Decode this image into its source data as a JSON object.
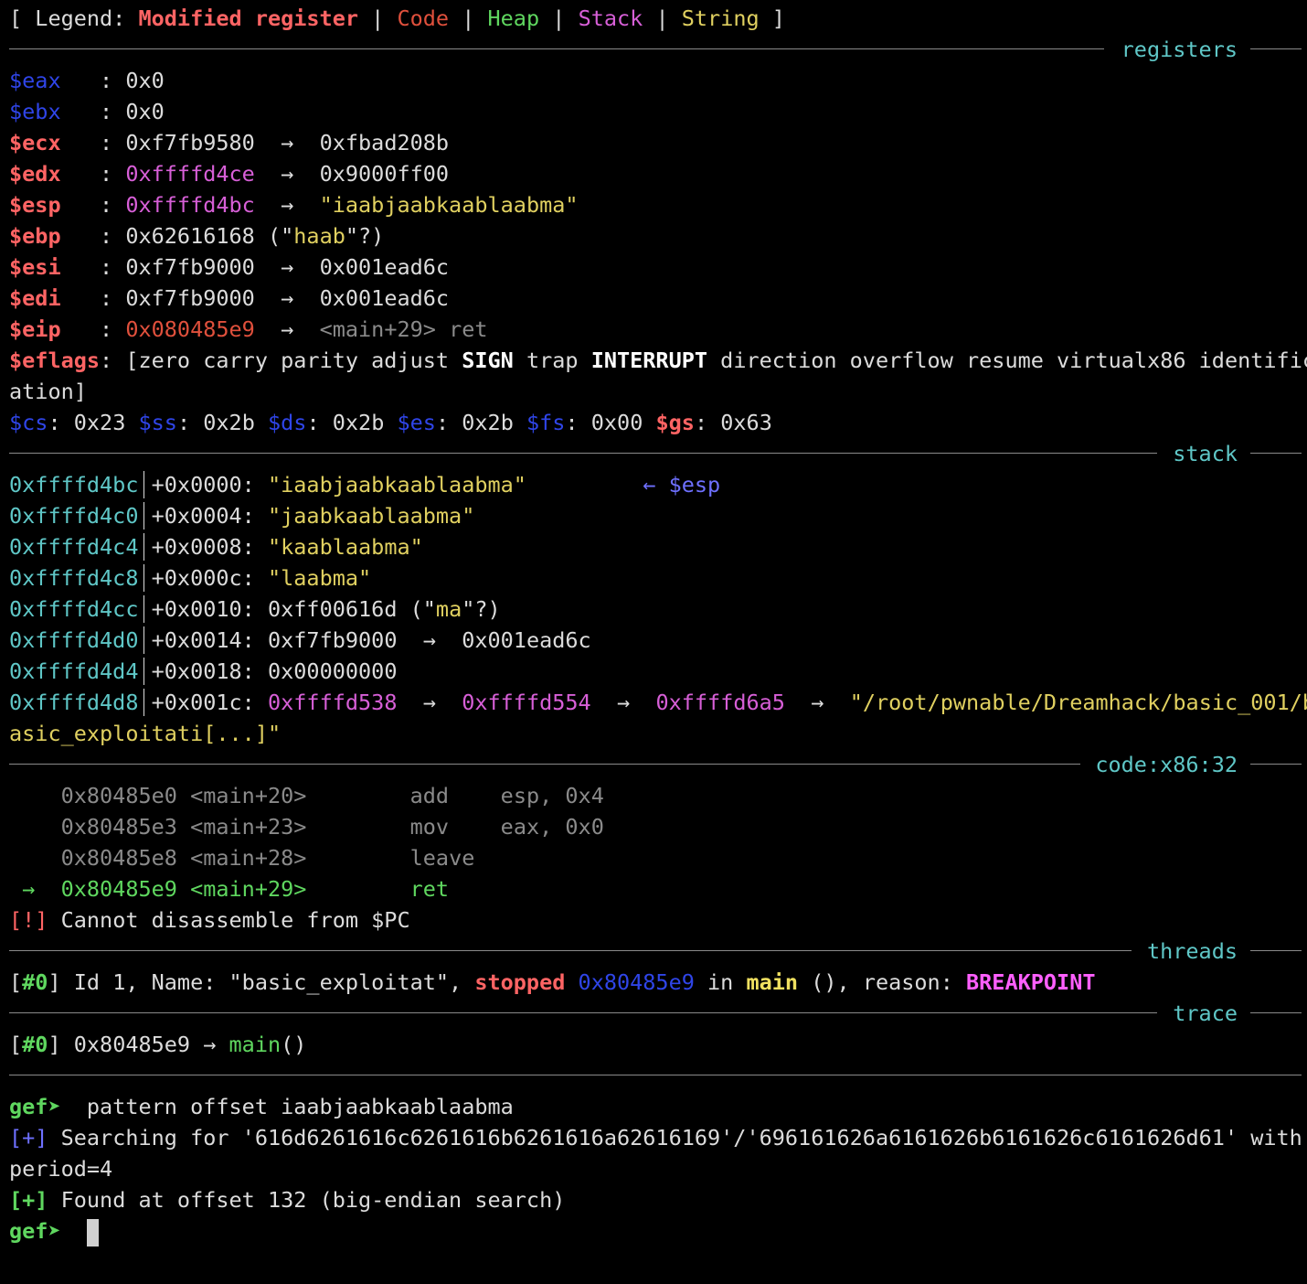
{
  "legend": {
    "open": "[ Legend: ",
    "modified": "Modified register",
    "pipe": " | ",
    "code": "Code",
    "heap": "Heap",
    "stack": "Stack",
    "string": "String",
    "close": " ]"
  },
  "sections": {
    "registers": "registers",
    "stack": "stack",
    "code": "code:x86:32",
    "threads": "threads",
    "trace": "trace"
  },
  "arrow": {
    "sep": "  →  "
  },
  "registers": {
    "eax": {
      "name": "$eax",
      "sep": "   : ",
      "value": "0x0"
    },
    "ebx": {
      "name": "$ebx",
      "sep": "   : ",
      "value": "0x0"
    },
    "ecx": {
      "name": "$ecx",
      "sep": "   : ",
      "value": "0xf7fb9580",
      "target": "0xfbad208b"
    },
    "edx": {
      "name": "$edx",
      "sep": "   : ",
      "value": "0xffffd4ce",
      "target": "0x9000ff00"
    },
    "esp": {
      "name": "$esp",
      "sep": "   : ",
      "value": "0xffffd4bc",
      "target": "\"iaabjaabkaablaabma\""
    },
    "ebp": {
      "name": "$ebp",
      "sep": "   : ",
      "value": "0x62616168",
      "pre": " (\"",
      "str": "haab",
      "post": "\"?)"
    },
    "esi": {
      "name": "$esi",
      "sep": "   : ",
      "value": "0xf7fb9000",
      "target": "0x001ead6c"
    },
    "edi": {
      "name": "$edi",
      "sep": "   : ",
      "value": "0xf7fb9000",
      "target": "0x001ead6c"
    },
    "eip": {
      "name": "$eip",
      "sep": "   : ",
      "value": "0x080485e9",
      "sym": "<main+29>",
      "instr": " ret"
    }
  },
  "eflags": {
    "name": "$eflags",
    "pre": ": [zero carry parity adjust ",
    "sign": "SIGN",
    "mid": " trap ",
    "interrupt": "INTERRUPT",
    "post": " direction overflow resume virtualx86 identific",
    "wrap": "ation]"
  },
  "segments": {
    "cs_name": "$cs",
    "cs_val": ": 0x23 ",
    "ss_name": "$ss",
    "ss_val": ": 0x2b ",
    "ds_name": "$ds",
    "ds_val": ": 0x2b ",
    "es_name": "$es",
    "es_val": ": 0x2b ",
    "fs_name": "$fs",
    "fs_val": ": 0x00 ",
    "gs_name": "$gs",
    "gs_val": ": 0x63"
  },
  "stack": {
    "pad": " ",
    "0": {
      "addr": "0xffffd4bc",
      "off": "+0x0000: ",
      "val": "\"iaabjaabkaablaabma\"",
      "note": "         ← $esp"
    },
    "1": {
      "addr": "0xffffd4c0",
      "off": "+0x0004: ",
      "val": "\"jaabkaablaabma\""
    },
    "2": {
      "addr": "0xffffd4c4",
      "off": "+0x0008: ",
      "val": "\"kaablaabma\""
    },
    "3": {
      "addr": "0xffffd4c8",
      "off": "+0x000c: ",
      "val": "\"laabma\""
    },
    "4": {
      "addr": "0xffffd4cc",
      "off": "+0x0010: ",
      "val": "0xff00616d",
      "pre": " (\"",
      "str": "ma",
      "post": "\"?)"
    },
    "5": {
      "addr": "0xffffd4d0",
      "off": "+0x0014: ",
      "val": "0xf7fb9000",
      "target": "0x001ead6c"
    },
    "6": {
      "addr": "0xffffd4d4",
      "off": "+0x0018: ",
      "val": "0x00000000"
    },
    "7": {
      "addr": "0xffffd4d8",
      "off": "+0x001c: ",
      "val": "0xffffd538",
      "t1": "0xffffd554",
      "t2": "0xffffd6a5",
      "str": "\"/root/pwnable/Dreamhack/basic_001/b",
      "wrap": "asic_exploitati[...]\""
    }
  },
  "code": {
    "pad": "    ",
    "arrow": " →  ",
    "sp": " ",
    "gap": "        ",
    "lines": [
      {
        "addr": "0x80485e0",
        "sym": "<main+20>",
        "op": "add",
        "args": "    esp, 0x4"
      },
      {
        "addr": "0x80485e3",
        "sym": "<main+23>",
        "op": "mov",
        "args": "    eax, 0x0"
      },
      {
        "addr": "0x80485e8",
        "sym": "<main+28>",
        "op": "leave"
      },
      {
        "addr": "0x80485e9",
        "sym": "<main+29>",
        "op": "ret"
      }
    ],
    "warn_tag": "[!]",
    "warn_text": " Cannot disassemble from $PC"
  },
  "threads": {
    "open": "[",
    "num": "#0",
    "desc": "] Id 1, Name: \"basic_exploitat\", ",
    "state": "stopped",
    "sp": " ",
    "addr": "0x80485e9",
    "in": " in ",
    "func": "main",
    "reason": " (), reason: ",
    "reason_value": "BREAKPOINT"
  },
  "trace": {
    "open": "[",
    "num": "#0",
    "addr": "] 0x80485e9 → ",
    "func": "main",
    "paren": "()"
  },
  "console": {
    "prompt": "gef➤",
    "command": "  pattern offset iaabjaabkaablaabma",
    "info_tag": "[+]",
    "search_line": " Searching for '616d6261616c6261616b6261616a62616169'/'696161626a6161626b6161626c6161626d61' with",
    "search_wrap": "period=4",
    "ok_tag": "[+]",
    "found_line": " Found at offset 132 (big-endian search)",
    "cursor_pad": "  "
  }
}
